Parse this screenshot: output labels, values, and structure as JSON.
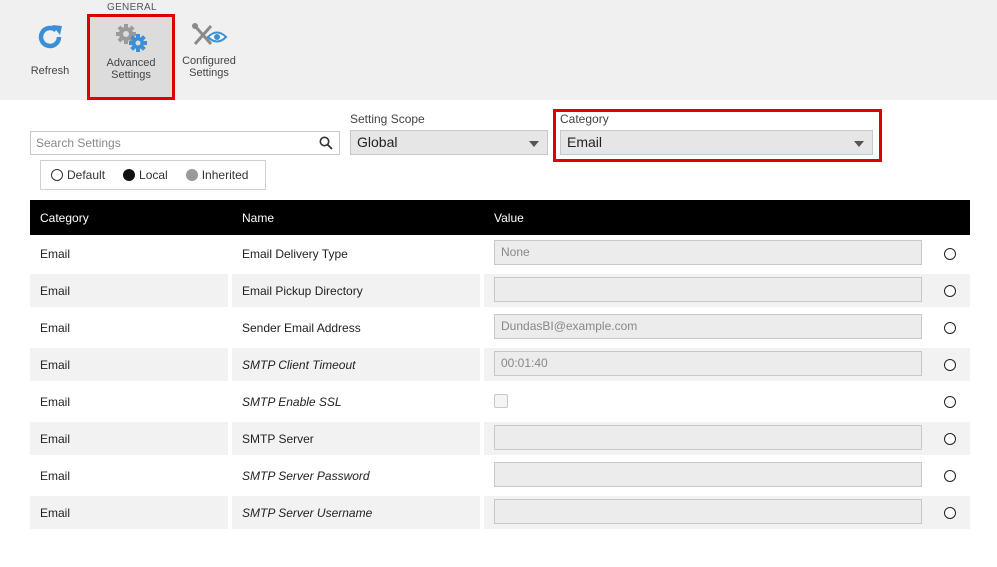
{
  "toolbar": {
    "group_label": "GENERAL",
    "refresh_label": "Refresh",
    "advanced_line1": "Advanced",
    "advanced_line2": "Settings",
    "configured_line1": "Configured",
    "configured_line2": "Settings",
    "accent_color": "#3a8fd6",
    "highlight_color": "#e00000"
  },
  "filters": {
    "search_placeholder": "Search Settings",
    "scope_label": "Setting Scope",
    "scope_value": "Global",
    "category_label": "Category",
    "category_value": "Email"
  },
  "legend": {
    "default_label": "Default",
    "local_label": "Local",
    "inherited_label": "Inherited"
  },
  "table": {
    "headers": {
      "category": "Category",
      "name": "Name",
      "value": "Value"
    },
    "rows": [
      {
        "category": "Email",
        "name": "Email Delivery Type",
        "value": "None",
        "italic": false,
        "type": "text"
      },
      {
        "category": "Email",
        "name": "Email Pickup Directory",
        "value": "",
        "italic": false,
        "type": "text"
      },
      {
        "category": "Email",
        "name": "Sender Email Address",
        "value": "DundasBI@example.com",
        "italic": false,
        "type": "text"
      },
      {
        "category": "Email",
        "name": "SMTP Client Timeout",
        "value": "00:01:40",
        "italic": true,
        "type": "text"
      },
      {
        "category": "Email",
        "name": "SMTP Enable SSL",
        "value": "",
        "italic": true,
        "type": "checkbox"
      },
      {
        "category": "Email",
        "name": "SMTP Server",
        "value": "",
        "italic": false,
        "type": "text"
      },
      {
        "category": "Email",
        "name": "SMTP Server Password",
        "value": "",
        "italic": true,
        "type": "text"
      },
      {
        "category": "Email",
        "name": "SMTP Server Username",
        "value": "",
        "italic": true,
        "type": "text"
      }
    ]
  }
}
